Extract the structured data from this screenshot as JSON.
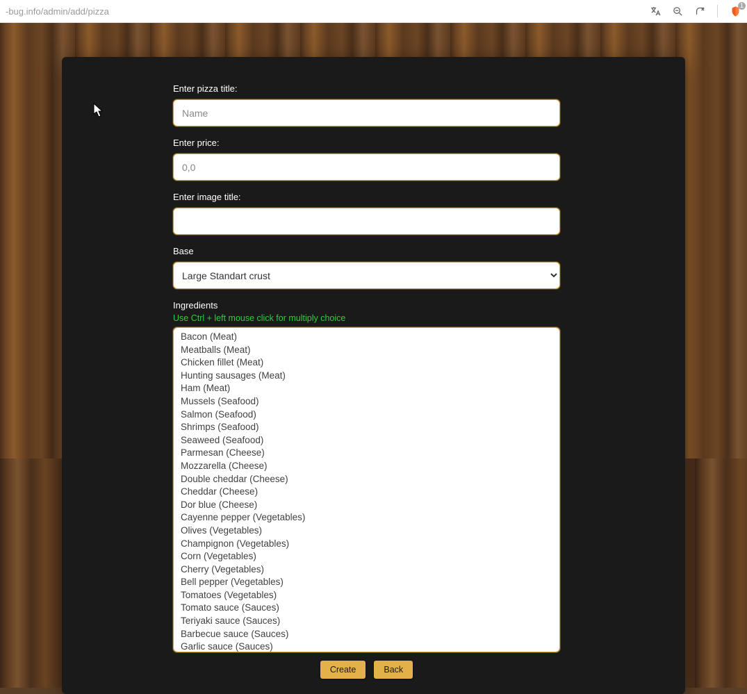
{
  "browser": {
    "url_host": "-bug.info",
    "url_path": "/admin/add/pizza",
    "shield_count": "1"
  },
  "form": {
    "title_label": "Enter pizza title:",
    "title_placeholder": "Name",
    "title_value": "",
    "price_label": "Enter price:",
    "price_placeholder": "0,0",
    "price_value": "",
    "image_label": "Enter image title:",
    "image_value": "",
    "base_label": "Base",
    "base_selected": "Large Standart crust",
    "ingredients_label": "Ingredients",
    "ingredients_hint": "Use Ctrl + left mouse click for multiply choice",
    "ingredients": [
      "Bacon (Meat)",
      "Meatballs (Meat)",
      "Chicken fillet (Meat)",
      "Hunting sausages (Meat)",
      "Ham (Meat)",
      "Mussels (Seafood)",
      "Salmon (Seafood)",
      "Shrimps (Seafood)",
      "Seaweed (Seafood)",
      "Parmesan (Cheese)",
      "Mozzarella (Cheese)",
      "Double cheddar (Cheese)",
      "Cheddar (Cheese)",
      "Dor blue (Cheese)",
      "Cayenne pepper (Vegetables)",
      "Olives (Vegetables)",
      "Champignon (Vegetables)",
      "Corn (Vegetables)",
      "Cherry (Vegetables)",
      "Bell pepper (Vegetables)",
      "Tomatoes (Vegetables)",
      "Tomato sauce (Sauces)",
      "Teriyaki sauce (Sauces)",
      "Barbecue sauce (Sauces)",
      "Garlic sauce (Sauces)"
    ],
    "create_button": "Create",
    "back_button": "Back"
  }
}
